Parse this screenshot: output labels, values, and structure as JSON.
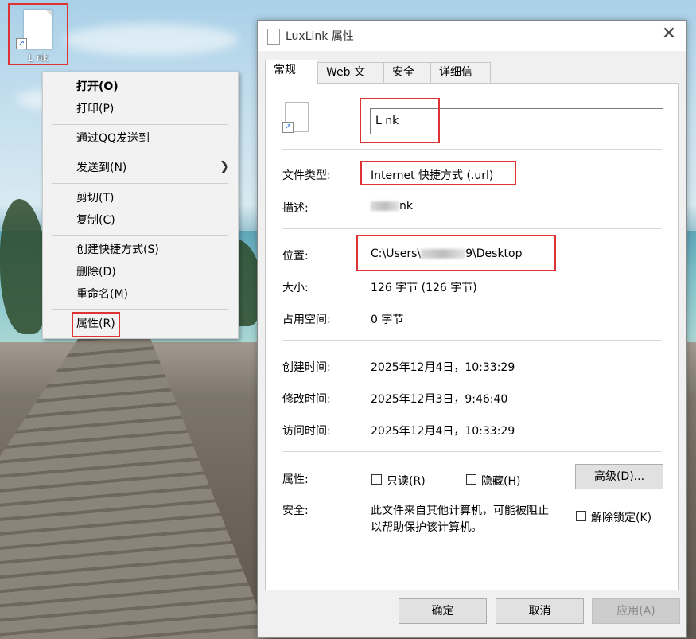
{
  "desktop": {
    "icon_label": "L    nk"
  },
  "context_menu": {
    "items": [
      {
        "label": "打开(O)"
      },
      {
        "label": "打印(P)"
      },
      {
        "label": "通过QQ发送到"
      },
      {
        "label": "发送到(N)"
      },
      {
        "label": "剪切(T)"
      },
      {
        "label": "复制(C)"
      },
      {
        "label": "创建快捷方式(S)"
      },
      {
        "label": "删除(D)"
      },
      {
        "label": "重命名(M)"
      },
      {
        "label": "属性(R)"
      }
    ],
    "submenu_arrow": "chevron-right-icon"
  },
  "dialog": {
    "title": "LuxLink 属性",
    "close_icon": "close-icon",
    "tabs": [
      {
        "label": "常规"
      },
      {
        "label": "Web 文档"
      },
      {
        "label": "安全"
      },
      {
        "label": "详细信息"
      }
    ],
    "name_value": "L     nk",
    "file_type_label": "文件类型:",
    "file_type_value": "Internet 快捷方式 (.url)",
    "description_label": "描述:",
    "description_value": "nk",
    "location_label": "位置:",
    "location_prefix": "C:\\Users\\",
    "location_suffix": "9\\Desktop",
    "size_label": "大小:",
    "size_value": "126 字节 (126 字节)",
    "disk_size_label": "占用空间:",
    "disk_size_value": "0 字节",
    "created_label": "创建时间:",
    "created_value": "2025年12月4日，10:33:29",
    "modified_label": "修改时间:",
    "modified_value": "2025年12月3日，9:46:40",
    "accessed_label": "访问时间:",
    "accessed_value": "2025年12月4日，10:33:29",
    "attributes_label": "属性:",
    "readonly_label": "只读(R)",
    "hidden_label": "隐藏(H)",
    "advanced_button": "高级(D)...",
    "security_label": "安全:",
    "security_text_line1": "此文件来自其他计算机，可能被阻止",
    "security_text_line2": "以帮助保护该计算机。",
    "unblock_label": "解除锁定(K)",
    "ok_button": "确定",
    "cancel_button": "取消",
    "apply_button": "应用(A)"
  },
  "colors": {
    "highlight_box": "#dd3333"
  }
}
